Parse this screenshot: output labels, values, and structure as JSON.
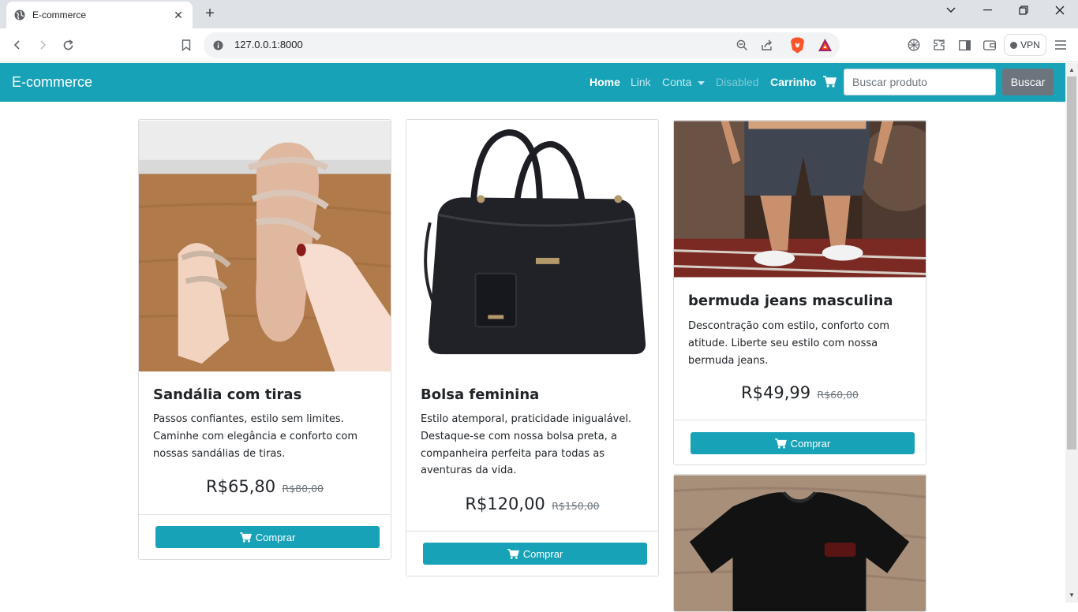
{
  "browser": {
    "tab_title": "E-commerce",
    "url": "127.0.0.1:8000",
    "vpn_label": "VPN"
  },
  "navbar": {
    "brand": "E-commerce",
    "links": [
      "Home",
      "Link",
      "Conta",
      "Disabled"
    ],
    "cart_label": "Carrinho",
    "search_placeholder": "Buscar produto",
    "search_button": "Buscar",
    "colors": {
      "bar": "#17a2b8",
      "active": "#ffffff",
      "muted": "#c3e9ef",
      "disabled": "#7fcad6"
    }
  },
  "products": [
    {
      "name": "Sandália com tiras",
      "description": "Passos confiantes, estilo sem limites. Caminhe com elegância e conforto com nossas sandálias de tiras.",
      "price": "R$65,80",
      "old_price": "R$80,00",
      "button": "Comprar"
    },
    {
      "name": "Bolsa feminina",
      "description": "Estilo atemporal, praticidade inigualável. Destaque-se com nossa bolsa preta, a companheira perfeita para todas as aventuras da vida.",
      "price": "R$120,00",
      "old_price": "R$150,00",
      "button": "Comprar"
    },
    {
      "name": "bermuda jeans masculina",
      "description": "Descontração com estilo, conforto com atitude. Liberte seu estilo com nossa bermuda jeans.",
      "price": "R$49,99",
      "old_price": "R$60,00",
      "button": "Comprar"
    }
  ]
}
